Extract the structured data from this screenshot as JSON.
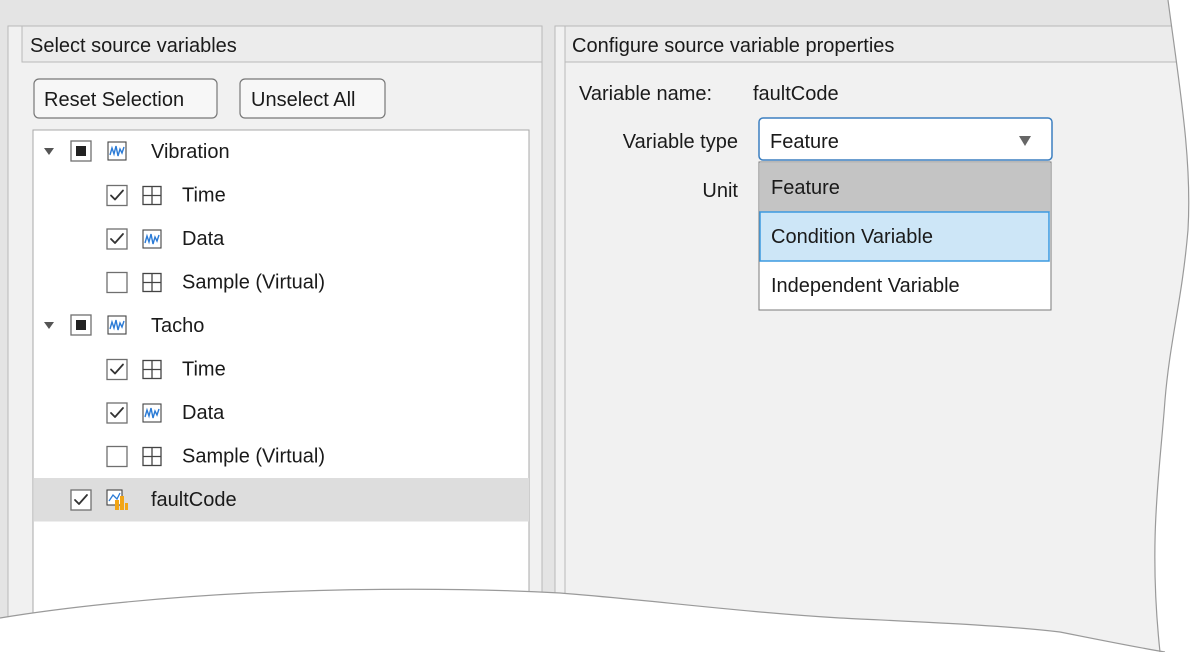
{
  "left_panel": {
    "title": "Select source variables",
    "reset_label": "Reset Selection",
    "unselect_label": "Unselect All",
    "tree": [
      {
        "label": "Vibration",
        "icon": "signal-icon",
        "state": "partial",
        "expanded": true,
        "children": [
          {
            "label": "Time",
            "icon": "table-icon",
            "checked": true
          },
          {
            "label": "Data",
            "icon": "signal-icon",
            "checked": true
          },
          {
            "label": "Sample (Virtual)",
            "icon": "table-icon",
            "checked": false
          }
        ]
      },
      {
        "label": "Tacho",
        "icon": "signal-icon",
        "state": "partial",
        "expanded": true,
        "children": [
          {
            "label": "Time",
            "icon": "table-icon",
            "checked": true
          },
          {
            "label": "Data",
            "icon": "signal-icon",
            "checked": true
          },
          {
            "label": "Sample (Virtual)",
            "icon": "table-icon",
            "checked": false
          }
        ]
      },
      {
        "label": "faultCode",
        "icon": "bar-chart-icon",
        "checked": true,
        "selected": true
      }
    ]
  },
  "right_panel": {
    "title": "Configure source variable properties",
    "variable_name_label": "Variable name:",
    "variable_name_value": "faultCode",
    "variable_type_label": "Variable type",
    "variable_type_value": "Feature",
    "unit_label": "Unit",
    "dropdown_options": [
      "Feature",
      "Condition Variable",
      "Independent Variable"
    ],
    "dropdown_selected_index": 0,
    "dropdown_highlighted_index": 1
  },
  "colors": {
    "panel_title_bg": "#ececec",
    "panel_border": "#b9b9b9",
    "selected_row": "#dddddd",
    "dropdown_border": "#3c7fc0",
    "option_selected_bg": "#c4c4c4",
    "option_hover_bg": "#cde6f7",
    "option_hover_border": "#3c9ae0",
    "icon_blue": "#2b7bd6",
    "icon_orange": "#f2a516"
  }
}
